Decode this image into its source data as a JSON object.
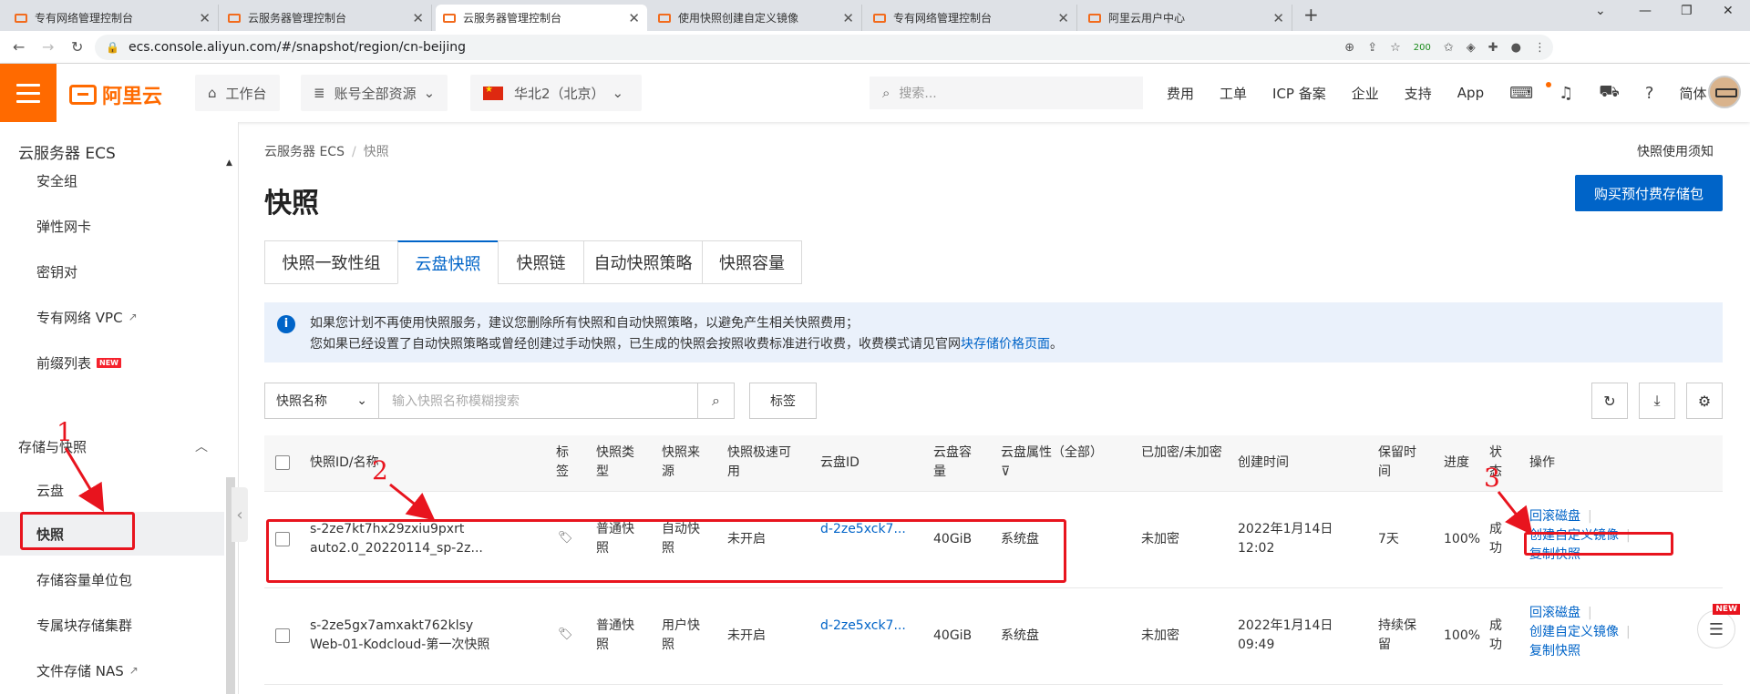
{
  "browser": {
    "tabs": [
      {
        "label": "专有网络管理控制台",
        "active": false
      },
      {
        "label": "云服务器管理控制台",
        "active": false
      },
      {
        "label": "云服务器管理控制台",
        "active": true
      },
      {
        "label": "使用快照创建自定义镜像",
        "active": false
      },
      {
        "label": "专有网络管理控制台",
        "active": false
      },
      {
        "label": "阿里云用户中心",
        "active": false
      }
    ],
    "url": "ecs.console.aliyun.com/#/snapshot/region/cn-beijing",
    "ext_badge": "200"
  },
  "topnav": {
    "brand": "阿里云",
    "workbench": "工作台",
    "resources": "账号全部资源",
    "region": "华北2（北京）",
    "search_placeholder": "搜索...",
    "links": [
      "费用",
      "工单",
      "ICP 备案",
      "企业",
      "支持",
      "App"
    ],
    "lang": "简体"
  },
  "sidebar": {
    "title": "云服务器 ECS",
    "items_top": [
      {
        "label": "安全组"
      },
      {
        "label": "弹性网卡"
      },
      {
        "label": "密钥对"
      },
      {
        "label": "专有网络 VPC",
        "external": true
      },
      {
        "label": "前缀列表",
        "badge": "NEW"
      }
    ],
    "group": "存储与快照",
    "items_group": [
      {
        "label": "云盘"
      },
      {
        "label": "快照",
        "active": true
      },
      {
        "label": "存储容量单位包"
      },
      {
        "label": "专属块存储集群"
      },
      {
        "label": "文件存储 NAS",
        "external": true
      }
    ]
  },
  "main": {
    "breadcrumb": [
      "云服务器 ECS",
      "快照"
    ],
    "notice_link": "快照使用须知",
    "title": "快照",
    "buy_button": "购买预付费存储包",
    "tabs": [
      {
        "label": "快照一致性组"
      },
      {
        "label": "云盘快照",
        "active": true
      },
      {
        "label": "快照链"
      },
      {
        "label": "自动快照策略"
      },
      {
        "label": "快照容量"
      }
    ],
    "alert": {
      "line1": "如果您计划不再使用快照服务，建议您删除所有快照和自动快照策略，以避免产生相关快照费用；",
      "line2_prefix": "您如果已经设置了自动快照策略或曾经创建过手动快照，已生成的快照会按照收费标准进行收费，收费模式请见官网",
      "line2_link": "块存储价格页面",
      "line2_suffix": "。"
    },
    "filter": {
      "select_value": "快照名称",
      "search_placeholder": "输入快照名称模糊搜索",
      "tag_button": "标签"
    },
    "table": {
      "headers": {
        "id": "快照ID/名称",
        "tag": "标签",
        "type": "快照类型",
        "source": "快照来源",
        "fast": "快照极速可用",
        "disk": "云盘ID",
        "size": "云盘容量",
        "attr": "云盘属性（全部）",
        "enc": "已加密/未加密",
        "created": "创建时间",
        "retain": "保留时间",
        "progress": "进度",
        "status": "状态",
        "ops": "操作"
      },
      "rows": [
        {
          "id": "s-2ze7kt7hx29zxiu9pxrt",
          "name": "auto2.0_20220114_sp-2z...",
          "type": "普通快照",
          "source": "自动快照",
          "fast": "未开启",
          "disk": "d-2ze5xck7...",
          "size": "40GiB",
          "attr": "系统盘",
          "enc": "未加密",
          "created_date": "2022年1月14日",
          "created_time": "12:02",
          "retain": "7天",
          "progress": "100%",
          "status": "成功",
          "ops": [
            "回滚磁盘",
            "创建自定义镜像",
            "复制快照"
          ]
        },
        {
          "id": "s-2ze5gx7amxakt762klsy",
          "name": "Web-01-Kodcloud-第一次快照",
          "type": "普通快照",
          "source": "用户快照",
          "fast": "未开启",
          "disk": "d-2ze5xck7...",
          "size": "40GiB",
          "attr": "系统盘",
          "enc": "未加密",
          "created_date": "2022年1月14日",
          "created_time": "09:49",
          "retain": "持续保留",
          "progress": "100%",
          "status": "成功",
          "ops": [
            "回滚磁盘",
            "创建自定义镜像",
            "复制快照"
          ]
        }
      ]
    }
  },
  "annotations": [
    "1",
    "2",
    "3"
  ],
  "floating_badge": "NEW"
}
